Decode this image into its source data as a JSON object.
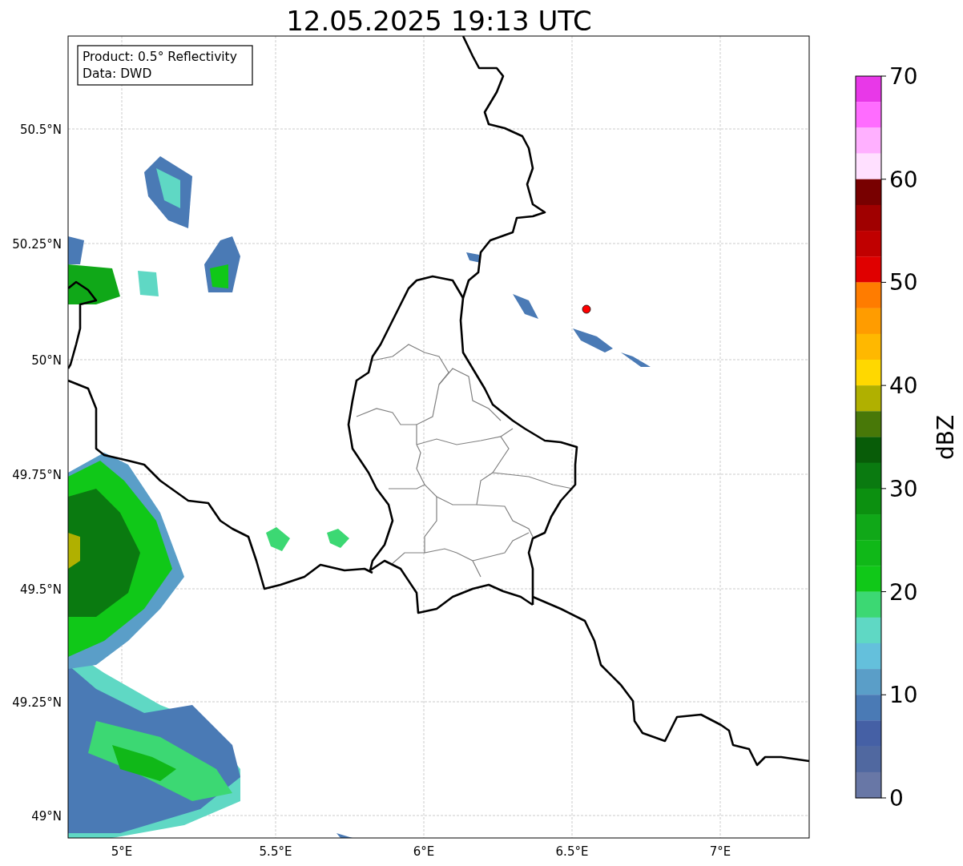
{
  "title": "12.05.2025 19:13 UTC",
  "info_box": [
    "Product: 0.5° Reflectivity",
    "Data: DWD"
  ],
  "map": {
    "lat_labels": [
      "50.5°N",
      "50.25°N",
      "50°N",
      "49.75°N",
      "49.5°N",
      "49.25°N",
      "49°N"
    ],
    "lon_labels": [
      "5°E",
      "5.5°E",
      "6°E",
      "6.5°E",
      "7°E"
    ]
  },
  "colorbar": {
    "label": "dBZ",
    "ticks": [
      "70",
      "60",
      "50",
      "40",
      "30",
      "20",
      "10",
      "0"
    ],
    "bands": [
      {
        "color": "#e838e8"
      },
      {
        "color": "#ff6cff"
      },
      {
        "color": "#ffb0ff"
      },
      {
        "color": "#ffe0ff"
      },
      {
        "color": "#780000"
      },
      {
        "color": "#a00000"
      },
      {
        "color": "#c00000"
      },
      {
        "color": "#e00000"
      },
      {
        "color": "#ff7c00"
      },
      {
        "color": "#ff9c00"
      },
      {
        "color": "#ffb800"
      },
      {
        "color": "#ffd800"
      },
      {
        "color": "#b0b000"
      },
      {
        "color": "#487808"
      },
      {
        "color": "#085c08"
      },
      {
        "color": "#0a7a10"
      },
      {
        "color": "#0c9010"
      },
      {
        "color": "#10a818"
      },
      {
        "color": "#10b818"
      },
      {
        "color": "#10c818"
      },
      {
        "color": "#3cd873"
      },
      {
        "color": "#5fd8c4"
      },
      {
        "color": "#64c0dc"
      },
      {
        "color": "#5a9ec8"
      },
      {
        "color": "#4a7ab5"
      },
      {
        "color": "#4560a5"
      },
      {
        "color": "#5068a0"
      },
      {
        "color": "#6877a6"
      }
    ]
  }
}
